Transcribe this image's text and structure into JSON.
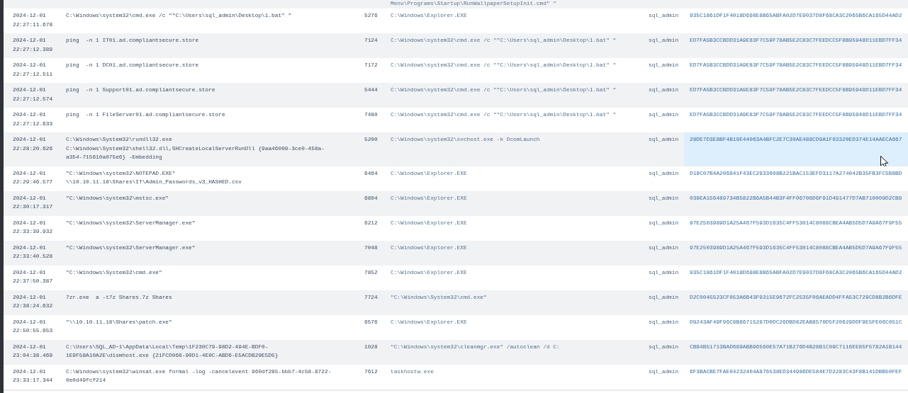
{
  "top_row": {
    "parent_command": "Menu\\Programs\\Startup\\RunWallpaperSetupInit.cmd\" \""
  },
  "rows": [
    {
      "time": "2024-12-01 22:27:11.678",
      "command": "C:\\Windows\\system32\\cmd.exe /c \"\"C:\\Users\\sql_admin\\Desktop\\1.bat\" \"",
      "pid": "5276",
      "parent_command": "C:\\Windows\\Explorer.EXE",
      "user": "sql_admin",
      "hash": "935C1861DF1F4018D698E8B65ABFA02D7E9037D8F68CA3C2065B6CA165D44AD2",
      "hovered": false
    },
    {
      "time": "2024-12-01 22:27:12.389",
      "command": "ping  -n 1 IT01.ad.compliantsecure.store",
      "pid": "7124",
      "parent_command": "C:\\Windows\\system32\\cmd.exe /c \"\"C:\\Users\\sql_admin\\Desktop\\1.bat\" \"",
      "user": "sql_admin",
      "hash": "ED7FA5B3CCBDD31A9E83F7C59F78AB5E2C83C7FEEDCC5F8B95948D11EBD7FF34",
      "hovered": false
    },
    {
      "time": "2024-12-01 22:27:12.511",
      "command": "ping  -n 1 DC01.ad.compliantsecure.store",
      "pid": "7172",
      "parent_command": "C:\\Windows\\system32\\cmd.exe /c \"\"C:\\Users\\sql_admin\\Desktop\\1.bat\" \"",
      "user": "sql_admin",
      "hash": "ED7FA5B3CCBDD31A9E83F7C59F78AB5E2C83C7FEEDCC5F8B95948D11EBD7FF34",
      "hovered": false
    },
    {
      "time": "2024-12-01 22:27:12.574",
      "command": "ping  -n 1 Support01.ad.compliantsecure.store",
      "pid": "5444",
      "parent_command": "C:\\Windows\\system32\\cmd.exe /c \"\"C:\\Users\\sql_admin\\Desktop\\1.bat\" \"",
      "user": "sql_admin",
      "hash": "ED7FA5B3CCBDD31A9E83F7C59F78AB5E2C83C7FEEDCC5F8B95948D11EBD7FF34",
      "hovered": false
    },
    {
      "time": "2024-12-01 22:27:12.633",
      "command": "ping  -n 1 FileServer01.ad.compliantsecure.store",
      "pid": "7480",
      "parent_command": "C:\\Windows\\system32\\cmd.exe /c \"\"C:\\Users\\sql_admin\\Desktop\\1.bat\" \"",
      "user": "sql_admin",
      "hash": "ED7FA5B3CCBDD31A9E83F7C59F78AB5E2C83C7FEEDCC5F8B95948D11EBD7FF34",
      "hovered": false
    },
    {
      "time": "2024-12-01 22:28:20.626",
      "command": "C:\\Windows\\System32\\rundll32.exe C:\\Windows\\System32\\shell32.dll,SHCreateLocalServerRunDll {9aa46009-3ce0-458a-a354-715610a075e6} -Embedding",
      "pid": "5200",
      "parent_command": "C:\\Windows\\system32\\svchost.exe -k DcomLaunch",
      "user": "sql_admin",
      "hash": "28DE7D3E8BF4B19E44063A4BFC2E7C30AE488CD9A1F63320ED374E14AAECA667",
      "hovered": true
    },
    {
      "time": "2024-12-01 22:29:46.577",
      "command": "\"C:\\Windows\\system32\\NOTEPAD.EXE\" \\\\10.10.11.18\\Shares\\IT\\Admin_Passwords_v3_HASHED.csv",
      "pid": "6464",
      "parent_command": "C:\\Windows\\Explorer.EXE",
      "user": "sql_admin",
      "hash": "D18C07B4A206841F43EC2933608B221BAC153EFD3117A274042B35FB3FC5B8BD",
      "hovered": false
    },
    {
      "time": "2024-12-01 22:30:17.317",
      "command": "\"C:\\Windows\\system32\\mstsc.exe\"",
      "pid": "6804",
      "parent_command": "C:\\Windows\\Explorer.EXE",
      "user": "sql_admin",
      "hash": "039EA156489734B5822B6A5B44B3F4FF06706D6F91D491477D7AB710009D2CB9",
      "hovered": false
    },
    {
      "time": "2024-12-01 22:33:39.932",
      "command": "\"C:\\Windows\\system32\\ServerManager.exe\"",
      "pid": "6212",
      "parent_command": "C:\\Windows\\Explorer.EXE",
      "user": "sql_admin",
      "hash": "97E2503989D1A25A467F593D1635C4FF53014C8088CBEA4AB5D5D7A9A67F9F55",
      "hovered": false
    },
    {
      "time": "2024-12-01 22:33:40.528",
      "command": "\"C:\\Windows\\system32\\ServerManager.exe\"",
      "pid": "7048",
      "parent_command": "C:\\Windows\\Explorer.EXE",
      "user": "sql_admin",
      "hash": "97E2503989D1A25A467F593D1635C4FF53014C8088CBEA4AB5D5D7A9A67F9F55",
      "hovered": false
    },
    {
      "time": "2024-12-01 22:37:50.387",
      "command": "\"C:\\Windows\\System32\\cmd.exe\"",
      "pid": "7852",
      "parent_command": "C:\\Windows\\Explorer.EXE",
      "user": "sql_admin",
      "hash": "935C1861DF1F4018D698E8B65ABFA02D7E9037D8F68CA3C2065B6CA165D44AD2",
      "hovered": false
    },
    {
      "time": "2024-12-01 22:38:24.632",
      "command": "7zr.exe  a -t7z Shares.7z Shares",
      "pid": "7724",
      "parent_command": "\"C:\\Windows\\System32\\cmd.exe\"",
      "user": "sql_admin",
      "hash": "D2C0045523CF053A6B43F9315E9672FC2535F06AEADD4FFA53C729CD8B2B6DFE",
      "hovered": false
    },
    {
      "time": "2024-12-01 22:50:55.653",
      "command": "\"\\\\10.10.11.18\\Shares\\patch.exe\"",
      "pid": "6576",
      "parent_command": "C:\\Windows\\Explorer.EXE",
      "user": "sql_admin",
      "hash": "D9243AF49F96C8B66715287D0DC26DBD82EAB8570D5F20629DDF9E5FE06C051C",
      "hovered": false
    },
    {
      "time": "2024-12-01 23:04:38.469",
      "command": "C:\\Users\\SQL_AD~1\\AppData\\Local\\Temp\\1F230C79-98D2-494E-BDF0-1E9F58A10A2E\\dismhost.exe {21FCD068-90D1-4E0C-ABD6-E5ACDB29E5D5}",
      "pid": "1028",
      "parent_command": "\"C:\\Windows\\system32\\cleanmgr.exe\" /autoclean /d C:",
      "user": "sql_admin",
      "hash": "CB84B51713BAD689ABB96560E57A71B276D4B28B1C09C7116EE85F5782A1B144",
      "hovered": false
    },
    {
      "time": "2024-12-01 23:33:17.344",
      "command": "C:\\Windows\\system32\\winsat.exe formal -log -cancelevent 960df285-bbb7-4c58-8722-0e0d49fcf214",
      "pid": "7612",
      "parent_command": "taskhostw.exe",
      "user": "sql_admin",
      "hash": "6F3BACBE7FAE04232404A876538ED344986DE584E7D2283C43F8B141DBB50FEF",
      "hovered": false
    }
  ]
}
